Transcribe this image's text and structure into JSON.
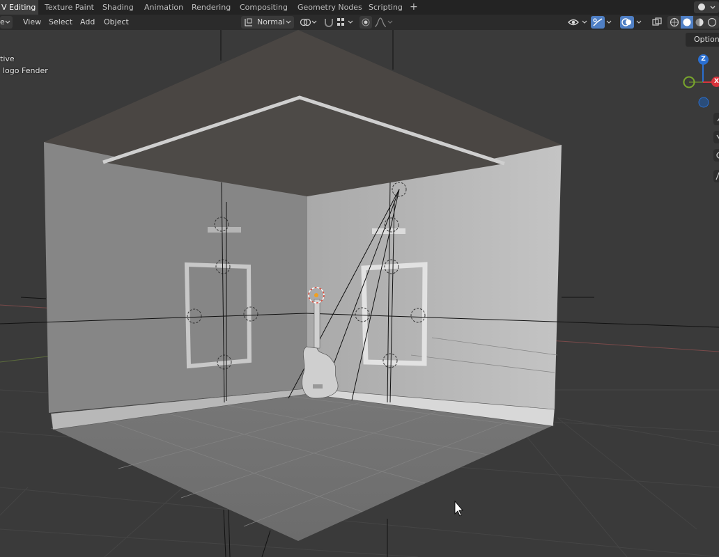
{
  "workspace_tabs": [
    {
      "label": "V Editing",
      "active": true
    },
    {
      "label": "Texture Paint",
      "active": false
    },
    {
      "label": "Shading",
      "active": false
    },
    {
      "label": "Animation",
      "active": false
    },
    {
      "label": "Rendering",
      "active": false
    },
    {
      "label": "Compositing",
      "active": false
    },
    {
      "label": "Geometry Nodes",
      "active": false
    },
    {
      "label": "Scripting",
      "active": false
    }
  ],
  "add_tab_glyph": "+",
  "header": {
    "mode_glyph": "e",
    "menus": [
      "View",
      "Select",
      "Add",
      "Object"
    ],
    "transform_orientation": "Normal"
  },
  "viewport": {
    "info_line1": "tive",
    "info_line2": "logo Fender",
    "options_label": "Options",
    "gizmo": {
      "z": "Z",
      "x": "X"
    }
  },
  "colors": {
    "topbar": "#232323",
    "header": "#2b2b2b",
    "viewport_bg": "#3a3a3a",
    "gizmo_z": "#2a6fd1",
    "gizmo_x": "#d8343c",
    "gizmo_y": "#7aa82c",
    "active_blue": "#4f7fc4"
  }
}
